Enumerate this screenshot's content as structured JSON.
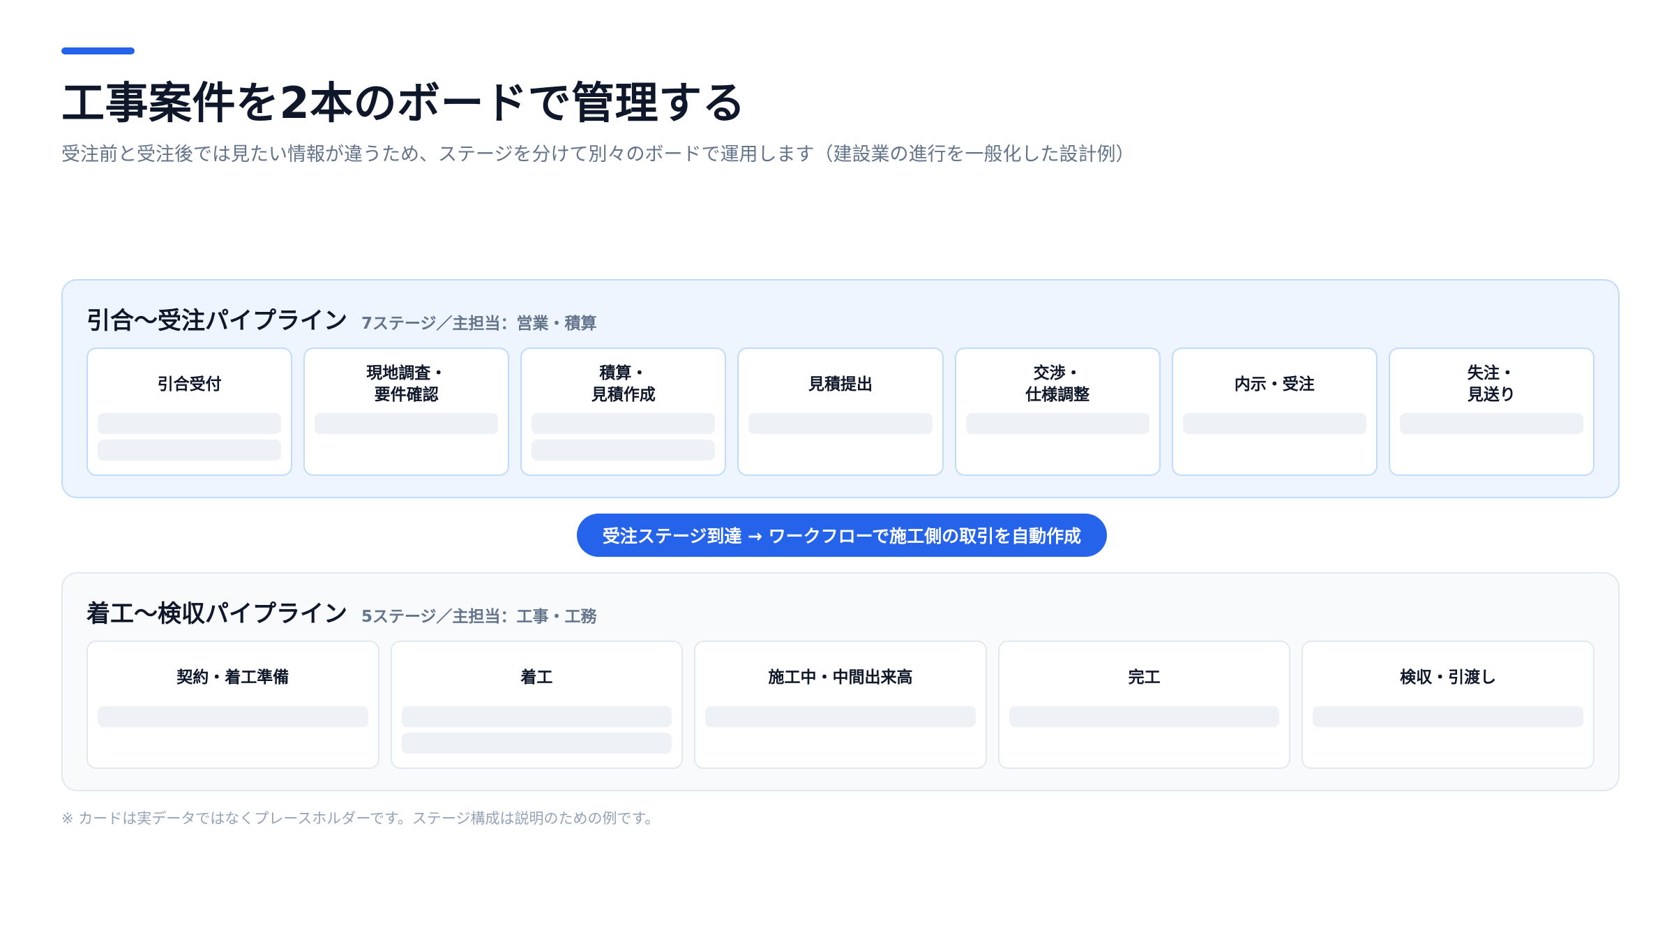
{
  "header": {
    "title": "工事案件を2本のボードで管理する",
    "subtitle": "受注前と受注後では見たい情報が違うため、ステージを分けて別々のボードで運用します（建設業の進行を一般化した設計例）"
  },
  "colors": {
    "accent": "#2563eb",
    "pipeline1_bg": "#eef5ff",
    "pipeline1_border": "#bfdbfe",
    "pipeline2_bg": "#f8fafc",
    "pipeline2_border": "#e2e8f0",
    "placeholder": "#eef2f6"
  },
  "pipeline1": {
    "title": "引合〜受注パイプライン",
    "meta": "7ステージ／主担当：営業・積算",
    "stages": [
      {
        "name": "引合受付",
        "placeholders": 2
      },
      {
        "name": "現地調査・\n要件確認",
        "placeholders": 1
      },
      {
        "name": "積算・\n見積作成",
        "placeholders": 2
      },
      {
        "name": "見積提出",
        "placeholders": 1
      },
      {
        "name": "交渉・\n仕様調整",
        "placeholders": 1
      },
      {
        "name": "内示・受注",
        "placeholders": 1
      },
      {
        "name": "失注・\n見送り",
        "placeholders": 1
      }
    ]
  },
  "connector": {
    "label": "受注ステージ到達 → ワークフローで施工側の取引を自動作成"
  },
  "pipeline2": {
    "title": "着工〜検収パイプライン",
    "meta": "5ステージ／主担当：工事・工務",
    "stages": [
      {
        "name": "契約・着工準備",
        "placeholders": 1
      },
      {
        "name": "着工",
        "placeholders": 2
      },
      {
        "name": "施工中・中間出来高",
        "placeholders": 1
      },
      {
        "name": "完工",
        "placeholders": 1
      },
      {
        "name": "検収・引渡し",
        "placeholders": 1
      }
    ]
  },
  "footnote": "※ カードは実データではなくプレースホルダーです。ステージ構成は説明のための例です。"
}
